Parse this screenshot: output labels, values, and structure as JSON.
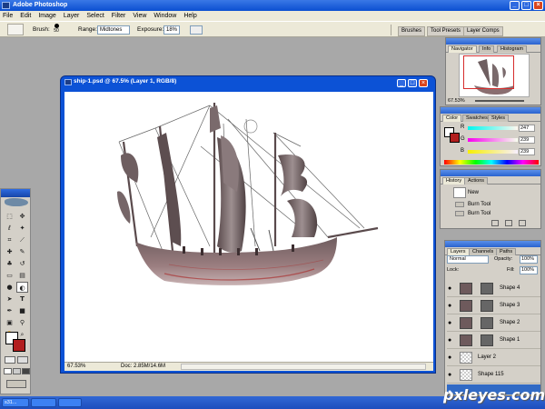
{
  "app": {
    "title": "Adobe Photoshop"
  },
  "menu": [
    "File",
    "Edit",
    "Image",
    "Layer",
    "Select",
    "Filter",
    "View",
    "Window",
    "Help"
  ],
  "options": {
    "brush_label": "Brush:",
    "brush_size": "50",
    "range_label": "Range:",
    "range_value": "Midtones",
    "exposure_label": "Exposure:",
    "exposure_value": "18%",
    "wells": [
      "Brushes",
      "Tool Presets",
      "Layer Comps"
    ]
  },
  "document": {
    "title": "ship-1.psd @ 67.5% (Layer 1, RGB/8)",
    "zoom": "67.53%",
    "doc_size": "Doc: 2.85M/14.6M"
  },
  "navigator": {
    "tabs": [
      "Navigator",
      "Info",
      "Histogram"
    ],
    "zoom": "67.53%"
  },
  "color": {
    "tabs": [
      "Color",
      "Swatches",
      "Styles"
    ],
    "channels": [
      {
        "label": "R",
        "value": "247"
      },
      {
        "label": "G",
        "value": "239"
      },
      {
        "label": "B",
        "value": "239"
      }
    ],
    "foreground": "#ffffff",
    "background": "#b21e1e"
  },
  "history": {
    "tabs": [
      "History",
      "Actions"
    ],
    "items": [
      "New",
      "Burn Tool",
      "Burn Tool"
    ]
  },
  "layers": {
    "tabs": [
      "Layers",
      "Channels",
      "Paths"
    ],
    "blend_mode": "Normal",
    "opacity_label": "Opacity:",
    "opacity": "100%",
    "lock_label": "Lock:",
    "fill_label": "Fill:",
    "fill": "100%",
    "items": [
      "Shape 4",
      "Shape 3",
      "Shape 2",
      "Shape 1",
      "Layer 2",
      "Shape 115",
      ""
    ]
  },
  "taskbar": {
    "items": [
      "s31...",
      ""
    ]
  },
  "watermark": "pxleyes.com"
}
